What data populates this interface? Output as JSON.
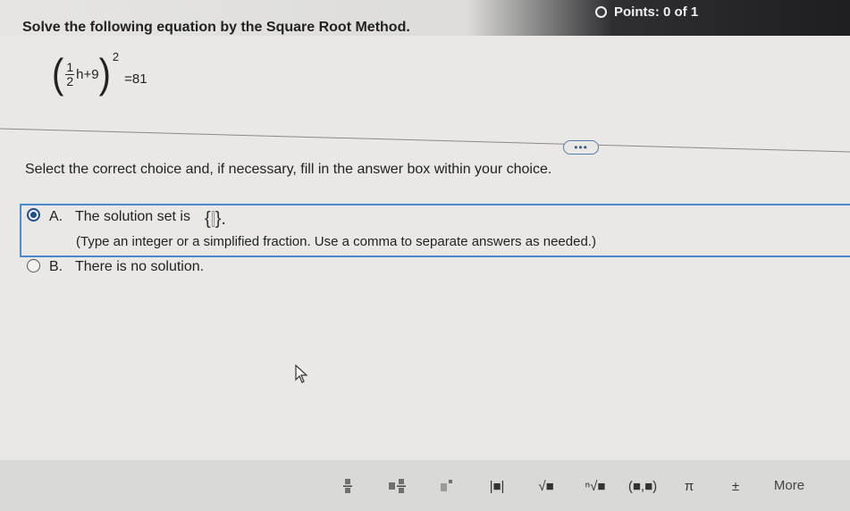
{
  "header": {
    "points_label": "Points: 0 of 1"
  },
  "question": {
    "prompt": "Solve the following equation by the Square Root Method.",
    "equation": {
      "fraction_numerator": "1",
      "fraction_denominator": "2",
      "inner_rest": "h+9",
      "exponent": "2",
      "rhs": "=81"
    },
    "more_pill": "•••",
    "instruction": "Select the correct choice and, if necessary, fill in the answer box within your choice."
  },
  "choices": [
    {
      "letter": "A.",
      "text": "The solution set is",
      "brace_open": "{",
      "brace_close": "}.",
      "answer_value": "",
      "hint": "(Type an integer or a simplified fraction. Use a comma to separate answers as needed.)",
      "selected": true
    },
    {
      "letter": "B.",
      "text": "There is no solution.",
      "selected": false
    }
  ],
  "toolbar": {
    "tools": [
      {
        "name": "fraction",
        "glyph": ""
      },
      {
        "name": "mixed-number",
        "glyph": ""
      },
      {
        "name": "exponent",
        "glyph": ""
      },
      {
        "name": "absolute-value",
        "glyph": "|■|"
      },
      {
        "name": "square-root",
        "glyph": "√■"
      },
      {
        "name": "nth-root",
        "glyph": "ⁿ√■"
      },
      {
        "name": "ordered-pair",
        "glyph": "(■,■)"
      },
      {
        "name": "pi",
        "glyph": "π"
      },
      {
        "name": "plus-minus",
        "glyph": "±"
      }
    ],
    "more_label": "More"
  },
  "colors": {
    "accent": "#4a8ad0",
    "radio_selected": "#1f4f8f"
  }
}
